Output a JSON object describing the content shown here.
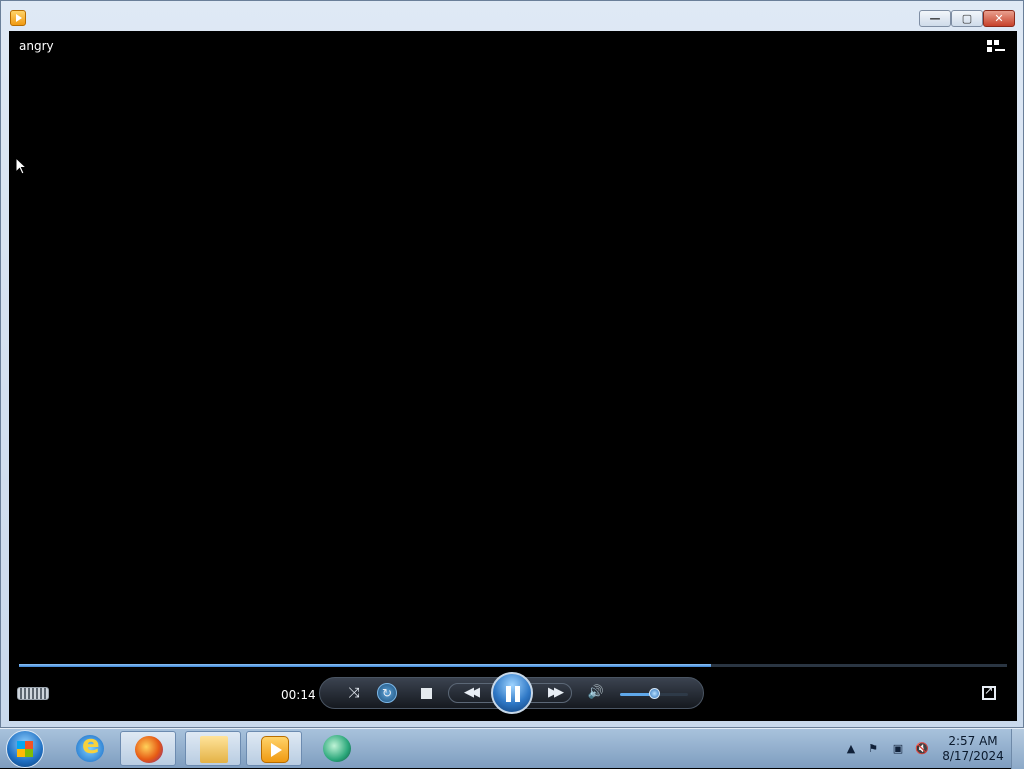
{
  "window": {
    "title": "",
    "caption_buttons": {
      "minimize": "—",
      "maximize": "▢",
      "close": "✕"
    }
  },
  "player": {
    "now_playing": "angry",
    "elapsed": "00:14",
    "progress_fraction": 0.7,
    "volume_fraction": 0.5,
    "state": "playing"
  },
  "taskbar": {
    "pinned": [
      {
        "name": "internet-explorer-icon"
      },
      {
        "name": "firefox-icon"
      },
      {
        "name": "file-explorer-icon"
      },
      {
        "name": "windows-media-player-icon"
      },
      {
        "name": "app-icon"
      }
    ],
    "clock": {
      "time": "2:57 AM",
      "date": "8/17/2024"
    }
  }
}
